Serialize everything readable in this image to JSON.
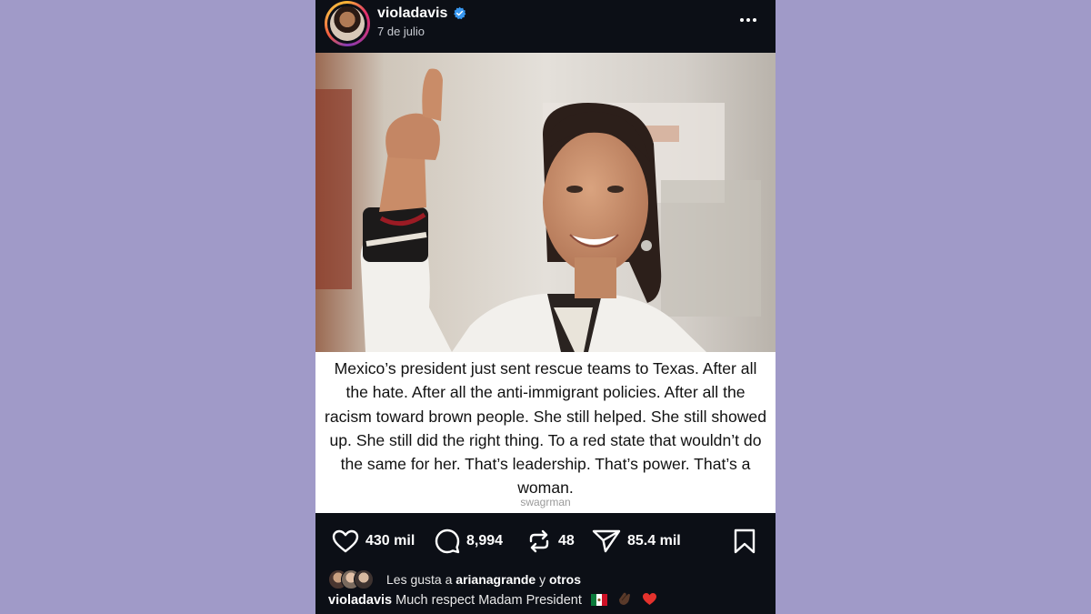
{
  "post": {
    "username": "violadavis",
    "date": "7 de julio",
    "caption": "Mexico’s president just sent rescue teams to Texas. After all the hate. After all the anti-immigrant policies. After all the racism toward brown people. She still helped. She still showed up. She still did the right thing. To a red state that wouldn’t do the same for her. That’s leadership. That’s power. That’s a woman.",
    "watermark": "swagrman"
  },
  "actions": {
    "likes": "430 mil",
    "comments": "8,994",
    "reposts": "48",
    "shares": "85.4 mil"
  },
  "liked_by": {
    "prefix": "Les gusta a",
    "user": "arianagrande",
    "joiner": "y",
    "rest": "otros"
  },
  "comment": {
    "username": "violadavis",
    "text": "Much respect Madam President",
    "emoji_flag": "🇲🇽",
    "emoji_clap": "👏🏿",
    "emoji_heart": "❤️"
  },
  "colors": {
    "background": "#a09ac8",
    "post_bg": "#0c0f16",
    "verified": "#3897f0",
    "heart_emoji": "#e5322d"
  }
}
